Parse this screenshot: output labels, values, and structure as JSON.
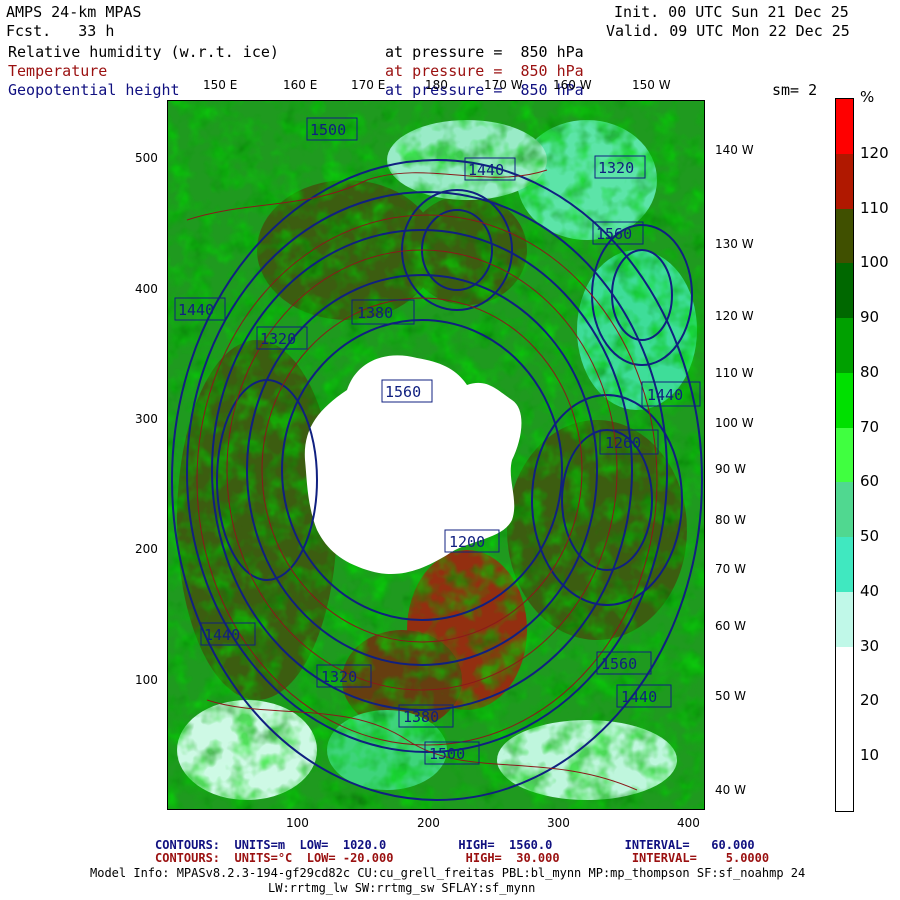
{
  "header": {
    "model": "AMPS 24-km MPAS",
    "fcst": "Fcst.   33 h",
    "init": "Init. 00 UTC Sun 21 Dec 25",
    "valid": "Valid. 09 UTC Mon 22 Dec 25"
  },
  "fields": [
    {
      "name": "Relative humidity (w.r.t. ice)",
      "level": "at pressure =  850 hPa",
      "color": "#000000"
    },
    {
      "name": "Temperature",
      "level": "at pressure =  850 hPa",
      "color": "#9a1010"
    },
    {
      "name": "Geopotential height",
      "level": "at pressure =  850 hPa",
      "color": "#101080"
    }
  ],
  "smoothing": "sm= 2",
  "top_lon_labels": [
    "150 E",
    "160 E",
    "170 E",
    "180",
    "170 W",
    "160 W",
    "150 W"
  ],
  "right_lon_labels": [
    "140 W",
    "130 W",
    "120 W",
    "110 W",
    "100 W",
    "90 W",
    "80 W",
    "70 W",
    "60 W",
    "50 W",
    "40 W"
  ],
  "y_ticks": [
    "500",
    "400",
    "300",
    "200",
    "100"
  ],
  "x_ticks": [
    "100",
    "200",
    "300",
    "400"
  ],
  "colorbar": {
    "unit": "%",
    "labels": [
      "120",
      "110",
      "100",
      "90",
      "80",
      "70",
      "60",
      "50",
      "40",
      "30",
      "20",
      "10"
    ],
    "colors": [
      "#ff0000",
      "#b01800",
      "#405000",
      "#006800",
      "#00a000",
      "#00e000",
      "#40ff40",
      "#50d890",
      "#40e8c0",
      "#c0f8e8",
      "#ffffff",
      "#ffffff",
      "#ffffff"
    ]
  },
  "height_labels": [
    "1500",
    "1440",
    "1320",
    "1560",
    "1380",
    "1440",
    "1320",
    "1440",
    "1260",
    "1560",
    "1200",
    "1440",
    "1320",
    "1380",
    "1500",
    "1560",
    "1440"
  ],
  "footer": {
    "c1": "CONTOURS:  UNITS=m  LOW=  1020.0          HIGH=  1560.0          INTERVAL=   60.000",
    "c2": "CONTOURS:  UNITS=°C  LOW= -20.000          HIGH=  30.000          INTERVAL=    5.0000",
    "info1": "Model Info: MPASv8.2.3-194-gf29cd82c CU:cu_grell_freitas PBL:bl_mynn MP:mp_thompson SF:sf_noahmp 24",
    "info2": "LW:rrtmg_lw SW:rrtmg_sw SFLAY:sf_mynn"
  }
}
